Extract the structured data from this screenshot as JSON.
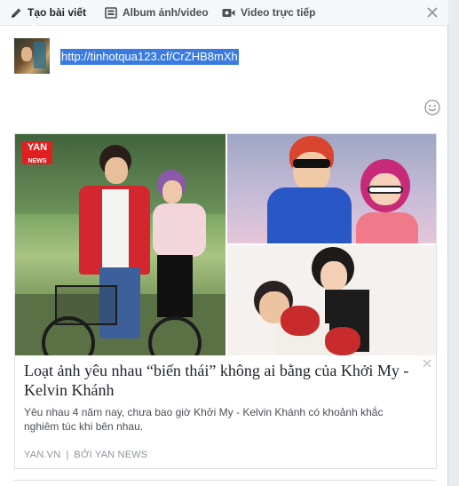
{
  "tabs": [
    {
      "label": "Tạo bài viết",
      "icon": "pencil-icon"
    },
    {
      "label": "Album ảnh/video",
      "icon": "album-icon"
    },
    {
      "label": "Video trực tiếp",
      "icon": "video-camera-icon"
    }
  ],
  "composer": {
    "text_value": "http://tinhotqua123.cf/CrZHB8mXh"
  },
  "link_preview": {
    "watermark": "YAN NEWS",
    "title": "Loạt ảnh yêu nhau “biến thái” không ai bằng của Khởi My - Kelvin Khánh",
    "description": "Yêu nhau 4 năm nay, chưa bao giờ Khởi My - Kelvin Khánh có khoảnh khắc nghiêm túc khi bên nhau.",
    "domain": "YAN.VN",
    "byline": "BỞI YAN NEWS"
  },
  "colors": {
    "accent": "#3b7be0",
    "selection": "#3b7be0"
  }
}
